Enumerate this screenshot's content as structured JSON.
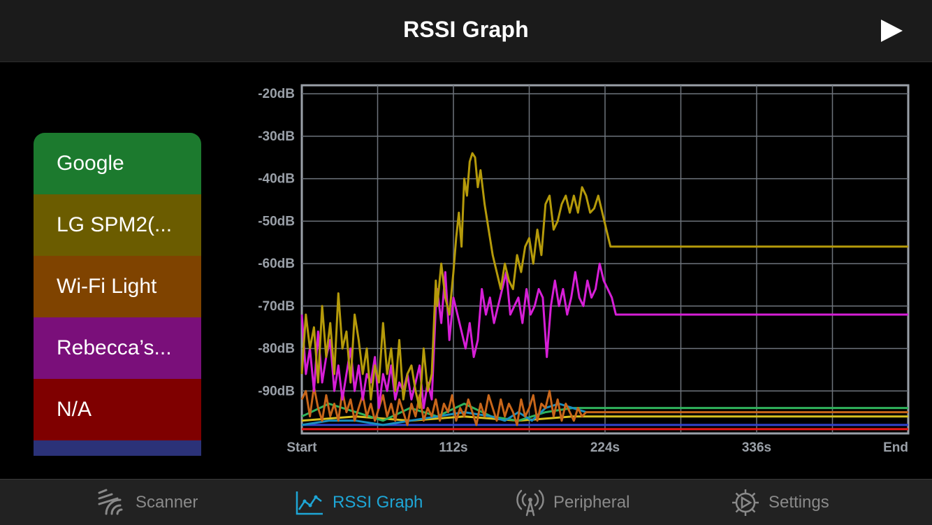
{
  "header": {
    "title": "RSSI Graph",
    "play_icon": "play-icon"
  },
  "legend": {
    "items": [
      {
        "label": "Google",
        "color": "#1c7a2e"
      },
      {
        "label": "LG SPM2(...",
        "color": "#6b5c00"
      },
      {
        "label": "Wi-Fi Light",
        "color": "#7f4300"
      },
      {
        "label": "Rebecca’s...",
        "color": "#7a0f7a"
      },
      {
        "label": "N/A",
        "color": "#7f0000"
      },
      {
        "label": "",
        "color": "#2b3278"
      }
    ]
  },
  "chart_data": {
    "type": "line",
    "xlabel": "",
    "ylabel": "",
    "xlim": [
      0,
      448
    ],
    "ylim": [
      -100,
      -18
    ],
    "x_ticks": [
      {
        "value": 0,
        "label": "Start"
      },
      {
        "value": 112,
        "label": "112s"
      },
      {
        "value": 224,
        "label": "224s"
      },
      {
        "value": 336,
        "label": "336s"
      },
      {
        "value": 448,
        "label": "End"
      }
    ],
    "y_ticks": [
      {
        "value": -20,
        "label": "-20dB"
      },
      {
        "value": -30,
        "label": "-30dB"
      },
      {
        "value": -40,
        "label": "-40dB"
      },
      {
        "value": -50,
        "label": "-50dB"
      },
      {
        "value": -60,
        "label": "-60dB"
      },
      {
        "value": -70,
        "label": "-70dB"
      },
      {
        "value": -80,
        "label": "-80dB"
      },
      {
        "value": -90,
        "label": "-90dB"
      }
    ],
    "grid": true,
    "series": [
      {
        "name": "LG SPM2(...",
        "color": "#b59a0a",
        "x": [
          0,
          3,
          6,
          9,
          12,
          15,
          18,
          21,
          24,
          27,
          30,
          33,
          36,
          39,
          42,
          45,
          48,
          51,
          54,
          57,
          60,
          63,
          66,
          69,
          72,
          75,
          78,
          81,
          84,
          87,
          90,
          93,
          96,
          99,
          100,
          103,
          106,
          109,
          112,
          114,
          116,
          118,
          120,
          122,
          124,
          126,
          128,
          130,
          132,
          135,
          138,
          141,
          144,
          147,
          150,
          153,
          156,
          159,
          162,
          165,
          168,
          171,
          174,
          177,
          180,
          183,
          186,
          189,
          192,
          195,
          198,
          201,
          204,
          207,
          210,
          213,
          216,
          219,
          222,
          225,
          228,
          231,
          234,
          448
        ],
        "y": [
          -86,
          -72,
          -80,
          -75,
          -88,
          -70,
          -82,
          -74,
          -86,
          -67,
          -80,
          -76,
          -88,
          -72,
          -78,
          -86,
          -80,
          -92,
          -84,
          -88,
          -74,
          -86,
          -80,
          -90,
          -78,
          -92,
          -86,
          -84,
          -90,
          -94,
          -80,
          -90,
          -86,
          -64,
          -70,
          -60,
          -68,
          -72,
          -62,
          -54,
          -48,
          -56,
          -40,
          -44,
          -36,
          -34,
          -35,
          -42,
          -38,
          -46,
          -52,
          -58,
          -62,
          -66,
          -60,
          -64,
          -66,
          -58,
          -62,
          -56,
          -54,
          -60,
          -52,
          -58,
          -46,
          -44,
          -52,
          -50,
          -46,
          -44,
          -48,
          -44,
          -48,
          -42,
          -44,
          -48,
          -47,
          -44,
          -48,
          -52,
          -56,
          -56,
          -56,
          -56
        ]
      },
      {
        "name": "Rebecca’s...",
        "color": "#d61fd6",
        "x": [
          0,
          3,
          6,
          9,
          12,
          15,
          18,
          21,
          24,
          27,
          30,
          33,
          36,
          39,
          42,
          45,
          48,
          51,
          54,
          57,
          60,
          63,
          66,
          69,
          72,
          75,
          78,
          81,
          84,
          87,
          90,
          93,
          96,
          99,
          100,
          103,
          106,
          109,
          112,
          115,
          118,
          121,
          124,
          127,
          130,
          133,
          136,
          139,
          142,
          145,
          148,
          151,
          154,
          157,
          160,
          163,
          166,
          169,
          172,
          175,
          178,
          181,
          184,
          187,
          190,
          193,
          196,
          199,
          202,
          205,
          208,
          211,
          214,
          217,
          220,
          223,
          226,
          229,
          232,
          448
        ],
        "y": [
          -72,
          -86,
          -80,
          -90,
          -76,
          -88,
          -82,
          -78,
          -90,
          -84,
          -92,
          -86,
          -80,
          -90,
          -84,
          -92,
          -86,
          -88,
          -82,
          -94,
          -86,
          -90,
          -84,
          -92,
          -88,
          -90,
          -86,
          -92,
          -88,
          -84,
          -94,
          -88,
          -92,
          -70,
          -66,
          -74,
          -62,
          -78,
          -68,
          -72,
          -76,
          -80,
          -74,
          -82,
          -78,
          -66,
          -72,
          -68,
          -74,
          -70,
          -66,
          -62,
          -72,
          -70,
          -68,
          -74,
          -66,
          -72,
          -70,
          -66,
          -68,
          -82,
          -70,
          -64,
          -70,
          -66,
          -72,
          -68,
          -62,
          -68,
          -70,
          -64,
          -68,
          -66,
          -60,
          -64,
          -66,
          -68,
          -72,
          -72
        ]
      },
      {
        "name": "Wi-Fi Light",
        "color": "#c8661a",
        "x": [
          0,
          3,
          6,
          9,
          12,
          15,
          18,
          21,
          24,
          27,
          30,
          33,
          36,
          39,
          42,
          45,
          48,
          51,
          54,
          57,
          60,
          63,
          66,
          69,
          72,
          75,
          78,
          81,
          84,
          87,
          90,
          93,
          96,
          99,
          102,
          105,
          108,
          111,
          114,
          117,
          120,
          123,
          126,
          129,
          132,
          135,
          138,
          141,
          144,
          147,
          150,
          153,
          156,
          159,
          162,
          165,
          168,
          171,
          174,
          177,
          180,
          183,
          186,
          189,
          192,
          195,
          198,
          201,
          204,
          207,
          210,
          448
        ],
        "y": [
          -92,
          -90,
          -96,
          -89,
          -94,
          -97,
          -91,
          -96,
          -93,
          -97,
          -90,
          -95,
          -92,
          -97,
          -94,
          -91,
          -96,
          -93,
          -97,
          -94,
          -91,
          -96,
          -93,
          -97,
          -92,
          -95,
          -98,
          -93,
          -96,
          -91,
          -97,
          -94,
          -96,
          -92,
          -97,
          -93,
          -95,
          -91,
          -97,
          -94,
          -96,
          -92,
          -95,
          -98,
          -93,
          -96,
          -91,
          -94,
          -97,
          -92,
          -96,
          -93,
          -95,
          -98,
          -92,
          -96,
          -94,
          -91,
          -97,
          -93,
          -94,
          -90,
          -96,
          -92,
          -97,
          -93,
          -95,
          -97,
          -94,
          -96,
          -95,
          -95
        ]
      },
      {
        "name": "Google",
        "color": "#2fb35c",
        "x": [
          0,
          20,
          40,
          60,
          80,
          100,
          120,
          140,
          160,
          180,
          200,
          210,
          448
        ],
        "y": [
          -96,
          -93,
          -95,
          -97,
          -94,
          -96,
          -93,
          -96,
          -97,
          -95,
          -94,
          -94,
          -94
        ]
      },
      {
        "name": "N/A",
        "color": "#e81818",
        "x": [
          0,
          448
        ],
        "y": [
          -99,
          -99
        ]
      },
      {
        "name": "",
        "color": "#3344cc",
        "x": [
          0,
          448
        ],
        "y": [
          -98,
          -98
        ]
      },
      {
        "name": "",
        "color": "#d8c020",
        "x": [
          0,
          40,
          80,
          120,
          160,
          200,
          210,
          448
        ],
        "y": [
          -97,
          -96,
          -97,
          -96,
          -97,
          -96,
          -96,
          -96
        ]
      },
      {
        "name": "",
        "color": "#1a8fbf",
        "x": [
          0,
          20,
          40,
          60,
          80,
          100,
          120,
          140,
          150,
          160,
          170,
          180,
          190,
          200,
          210
        ],
        "y": [
          -98,
          -97,
          -97,
          -98,
          -97,
          -96,
          -95,
          -96,
          -97,
          -95,
          -97,
          -94,
          -93,
          -94,
          -95
        ]
      }
    ]
  },
  "tabs": [
    {
      "label": "Scanner",
      "icon": "scanner-icon",
      "active": false
    },
    {
      "label": "RSSI Graph",
      "icon": "graph-icon",
      "active": true
    },
    {
      "label": "Peripheral",
      "icon": "antenna-icon",
      "active": false
    },
    {
      "label": "Settings",
      "icon": "gear-icon",
      "active": false
    }
  ]
}
